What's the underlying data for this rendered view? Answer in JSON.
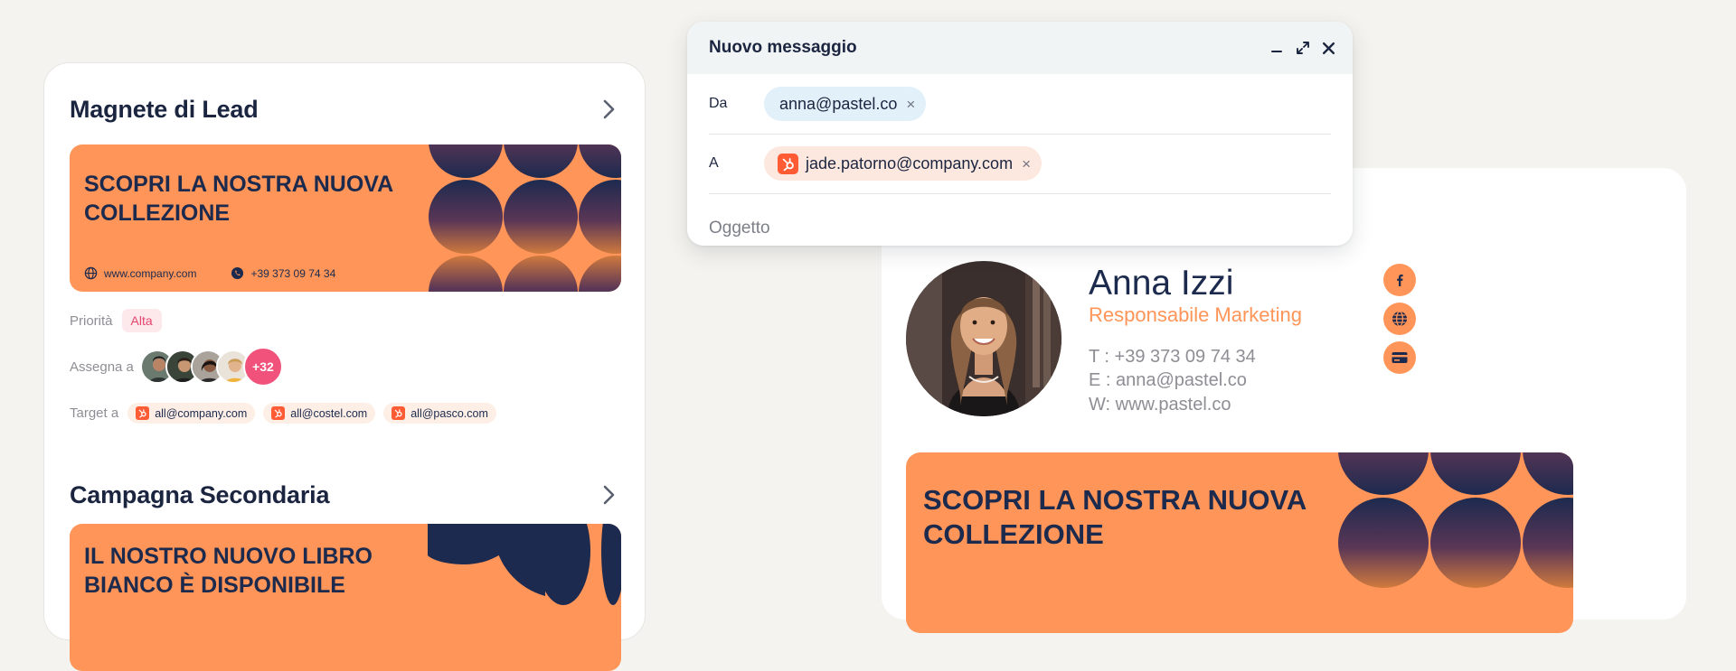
{
  "lead_card": {
    "title": "Magnete di Lead",
    "banner": {
      "headline": "SCOPRI LA NOSTRA NUOVA COLLEZIONE",
      "website": "www.company.com",
      "phone": "+39 373 09 74 34"
    },
    "priority": {
      "label": "Priorità",
      "value": "Alta"
    },
    "assign": {
      "label": "Assegna a",
      "more": "+32"
    },
    "target": {
      "label": "Target a",
      "chips": [
        "all@company.com",
        "all@costel.com",
        "all@pasco.com"
      ]
    }
  },
  "secondary_card": {
    "title": "Campagna Secondaria",
    "banner_headline": "IL NOSTRO NUOVO LIBRO BIANCO È DISPONIBILE"
  },
  "compose": {
    "title": "Nuovo messaggio",
    "from_label": "Da",
    "from_value": "anna@pastel.co",
    "to_label": "A",
    "to_value": "jade.patorno@company.com",
    "subject_placeholder": "Oggetto",
    "remove_glyph": "×"
  },
  "signature": {
    "name": "Anna Izzi",
    "role": "Responsabile Marketing",
    "phone_line": "T : +39 373 09 74 34",
    "email_line": "E : anna@pastel.co",
    "web_line": "W: www.pastel.co",
    "socials": [
      "facebook-icon",
      "globe-icon",
      "card-icon"
    ],
    "banner_headline": "SCOPRI LA NOSTRA NUOVA COLLEZIONE"
  },
  "colors": {
    "accent_orange": "#ff9558",
    "navy": "#1c2a4d",
    "priority_pink": "#e6456e",
    "hubspot_orange": "#ff5c35",
    "background": "#f4f3ef"
  }
}
